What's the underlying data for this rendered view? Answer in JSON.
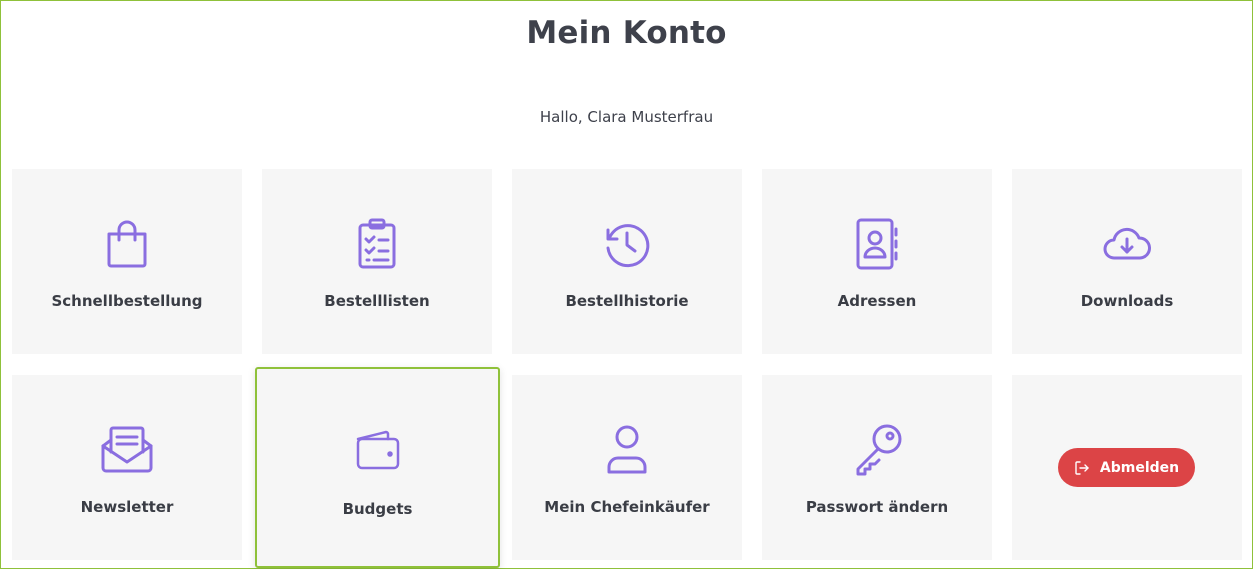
{
  "page": {
    "title": "Mein Konto",
    "greeting": "Hallo, Clara Musterfrau"
  },
  "colors": {
    "accent_icon": "#8a6ee0",
    "tile_background": "#f6f6f6",
    "active_border": "#8fc13a",
    "logout_button": "#dc4446"
  },
  "tiles": [
    {
      "label": "Schnellbestellung",
      "icon": "shopping-bag-icon"
    },
    {
      "label": "Bestelllisten",
      "icon": "clipboard-checklist-icon"
    },
    {
      "label": "Bestellhistorie",
      "icon": "history-clock-icon"
    },
    {
      "label": "Adressen",
      "icon": "address-book-icon"
    },
    {
      "label": "Downloads",
      "icon": "cloud-download-icon"
    },
    {
      "label": "Newsletter",
      "icon": "envelope-open-icon"
    },
    {
      "label": "Budgets",
      "icon": "wallet-icon"
    },
    {
      "label": "Mein Chefeinkäufer",
      "icon": "user-icon"
    },
    {
      "label": "Passwort ändern",
      "icon": "key-icon"
    }
  ],
  "logout": {
    "label": "Abmelden",
    "icon": "logout-icon"
  }
}
